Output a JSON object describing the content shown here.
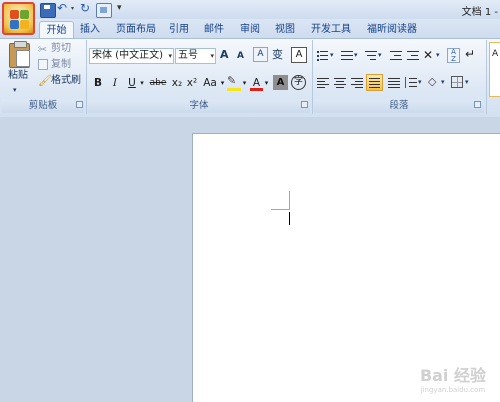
{
  "window": {
    "title": "文档 1 -"
  },
  "tabs": [
    {
      "label": "开始"
    },
    {
      "label": "插入"
    },
    {
      "label": "页面布局"
    },
    {
      "label": "引用"
    },
    {
      "label": "邮件"
    },
    {
      "label": "审阅"
    },
    {
      "label": "视图"
    },
    {
      "label": "开发工具"
    },
    {
      "label": "福昕阅读器"
    }
  ],
  "clipboard": {
    "paste": "粘贴",
    "cut": "剪切",
    "copy": "复制",
    "format_painter": "格式刷",
    "group_label": "剪贴板"
  },
  "font": {
    "font_name": "宋体 (中文正文)",
    "font_size": "五号",
    "grow": "A",
    "shrink": "A",
    "phonetic": "变",
    "bold": "B",
    "italic": "I",
    "underline": "U",
    "strikethrough": "abe",
    "subscript": "x₂",
    "superscript": "x²",
    "change_case": "Aa",
    "font_color": "A",
    "char_shading": "A",
    "enclose": "字",
    "group_label": "字体"
  },
  "paragraph": {
    "group_label": "段落"
  },
  "styles": {
    "sample": "A"
  },
  "watermark": {
    "line1": "Bai 经验",
    "line2": "jingyan.baidu.com"
  },
  "colors": {
    "highlight": "#f5e61a",
    "font_color": "#e0201a",
    "office_ring": "#e0453a"
  }
}
